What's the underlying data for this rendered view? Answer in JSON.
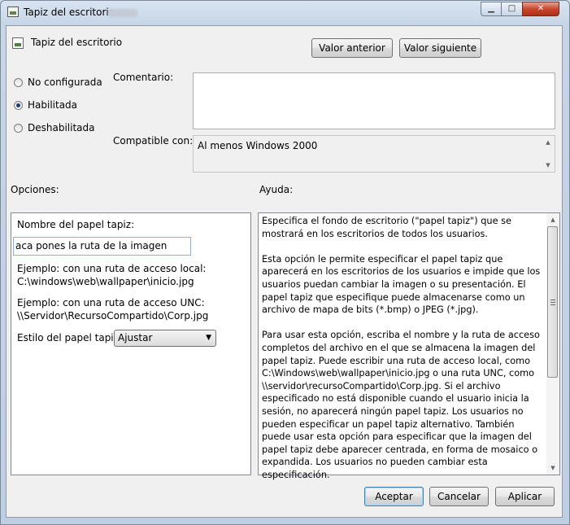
{
  "window": {
    "title": "Tapiz del escritorio",
    "controls": {
      "minimize": "▁",
      "maximize": "□",
      "close": "✕"
    }
  },
  "policy": {
    "name": "Tapiz del escritorio",
    "prev_label": "Valor anterior",
    "next_label": "Valor siguiente"
  },
  "state": {
    "options": [
      {
        "label": "No configurada",
        "checked": false
      },
      {
        "label": "Habilitada",
        "checked": true
      },
      {
        "label": "Deshabilitada",
        "checked": false
      }
    ]
  },
  "comment": {
    "label": "Comentario:",
    "value": ""
  },
  "compat": {
    "label": "Compatible con:",
    "value": "Al menos Windows 2000"
  },
  "options_section": {
    "label": "Opciones:",
    "name_label": "Nombre del papel tapiz:",
    "name_value": "aca pones la ruta de la imagen",
    "local_example": "Ejemplo: con una ruta de acceso local:\nC:\\windows\\web\\wallpaper\\inicio.jpg",
    "unc_example": "Ejemplo: con una ruta de acceso UNC:\n\\\\Servidor\\RecursoCompartido\\Corp.jpg",
    "style_label": "Estilo del papel tapiz:",
    "style_value": "Ajustar"
  },
  "help": {
    "label": "Ayuda:",
    "text": "Especifica el fondo de escritorio (\"papel tapiz\") que se mostrará en los escritorios de todos los usuarios.\n\nEsta opción le permite especificar el papel tapiz que aparecerá en los escritorios de los usuarios e impide que los usuarios puedan cambiar la imagen o su presentación. El papel tapiz que especifique puede almacenarse como un archivo de mapa de bits (*.bmp) o JPEG (*.jpg).\n\nPara usar esta opción, escriba el nombre y la ruta de acceso completos del archivo en el que se almacena la imagen del papel tapiz. Puede escribir una ruta de acceso local, como C:\\Windows\\web\\wallpaper\\inicio.jpg o una ruta UNC, como \\\\servidor\\recursoCompartido\\Corp.jpg. Si el archivo especificado no está disponible cuando el usuario inicia la sesión, no aparecerá ningún papel tapiz. Los usuarios no pueden especificar un papel tapiz alternativo. También puede usar esta opción para especificar que la imagen del papel tapiz debe aparecer centrada, en forma de mosaico o expandida. Los usuarios no pueden cambiar esta especificación."
  },
  "footer": {
    "accept_label": "Aceptar",
    "cancel_label": "Cancelar",
    "apply_label": "Aplicar"
  }
}
